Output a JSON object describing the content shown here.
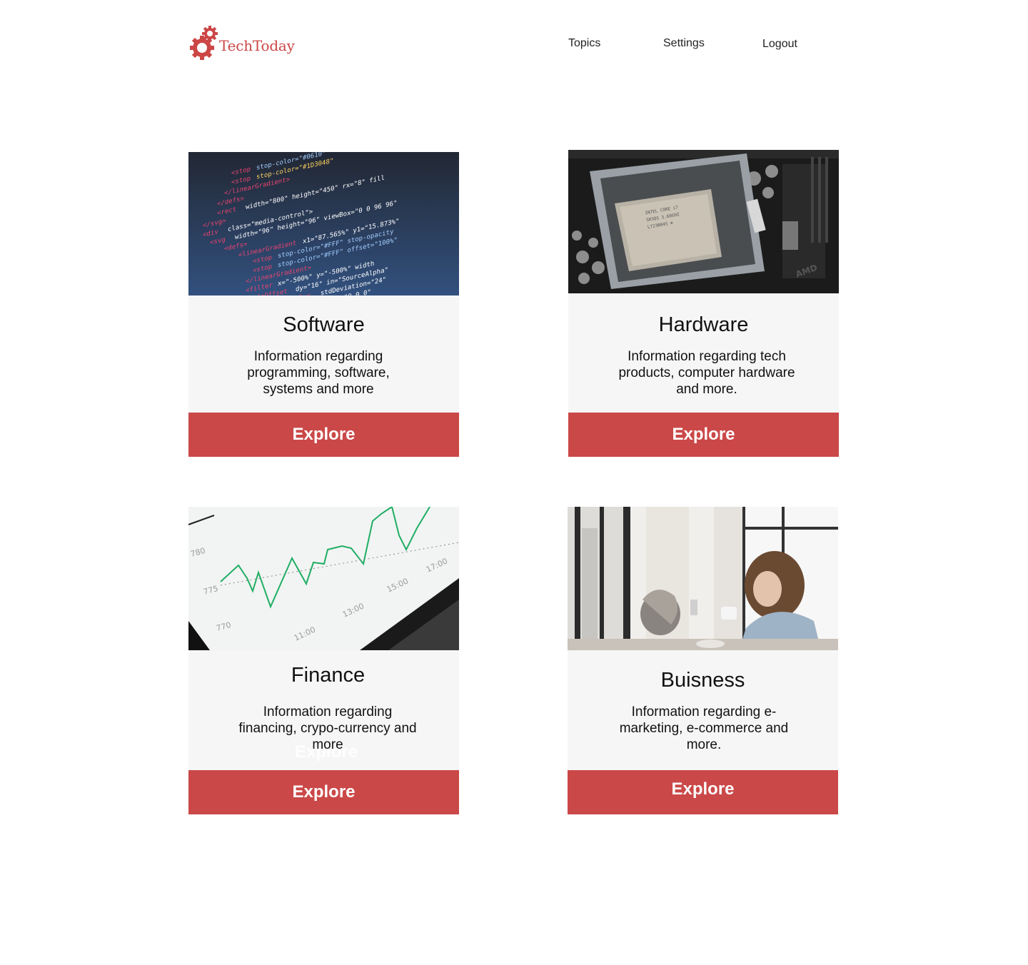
{
  "header": {
    "logo_text": "TechToday",
    "nav": {
      "topics": "Topics",
      "settings": "Settings",
      "logout": "Logout"
    }
  },
  "cards": [
    {
      "title": "Software",
      "description": "Information regarding programming, software, systems and more",
      "button": "Explore",
      "image": "code-editor-photo"
    },
    {
      "title": "Hardware",
      "description": "Information regarding tech products, computer hardware and more.",
      "button": "Explore",
      "image": "cpu-motherboard-photo"
    },
    {
      "title": "Finance",
      "description": "Information regarding financing, crypo-currency and more",
      "button": "Explore",
      "ghost_label": "Explore",
      "image": "stock-chart-photo",
      "chart_ticks": [
        "780",
        "775",
        "770",
        "11:00",
        "13:00",
        "15:00",
        "17:00"
      ]
    },
    {
      "title": "Buisness",
      "description": "Information regarding e-marketing, e-commerce and more.",
      "button": "Explore",
      "image": "woman-in-cafe-photo"
    }
  ],
  "colors": {
    "brand": "#cc4646",
    "button": "#cb4848",
    "card_bg": "#f6f6f6"
  }
}
